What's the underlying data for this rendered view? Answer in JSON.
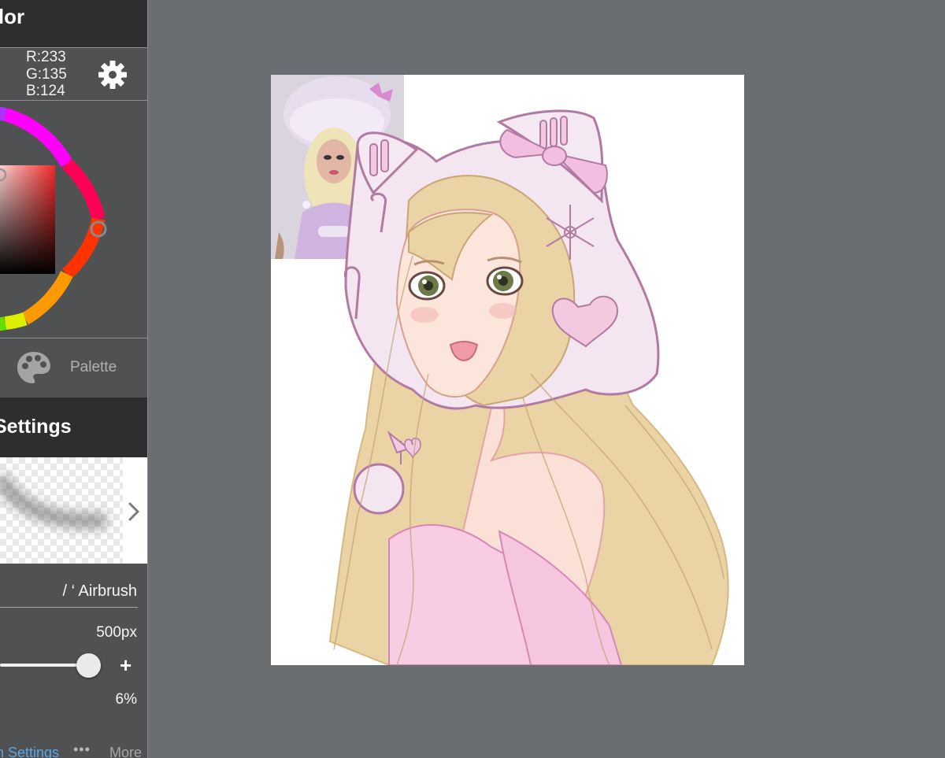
{
  "color_panel": {
    "title": "olor",
    "rgb": {
      "r": "R:233",
      "g": "G:135",
      "b": "B:124"
    },
    "current_color": "#e9877c",
    "icons": {
      "settings": "gear-icon",
      "wheel": "color-wheel"
    }
  },
  "tools": {
    "palette_label": "Palette",
    "palette_icon": "palette-icon"
  },
  "brush_panel": {
    "title": "Settings",
    "brush_name": "/ ‘ Airbrush",
    "size": "500px",
    "opacity": "6%",
    "size_level": 0.9,
    "plus_label": "+",
    "next_icon": "chevron-right-icon"
  },
  "bottom": {
    "settings_link": "sh Settings",
    "dots": "•••",
    "more": "More"
  },
  "colors": {
    "panel_bg": "#505153",
    "header_bg": "#2e2e30",
    "workspace_bg": "#6a6d71",
    "link": "#58a6e6",
    "hair": "#e9d0a0",
    "hood": "#f3e6f1",
    "outline": "#b27aa3",
    "pink": "#f8cde4"
  }
}
